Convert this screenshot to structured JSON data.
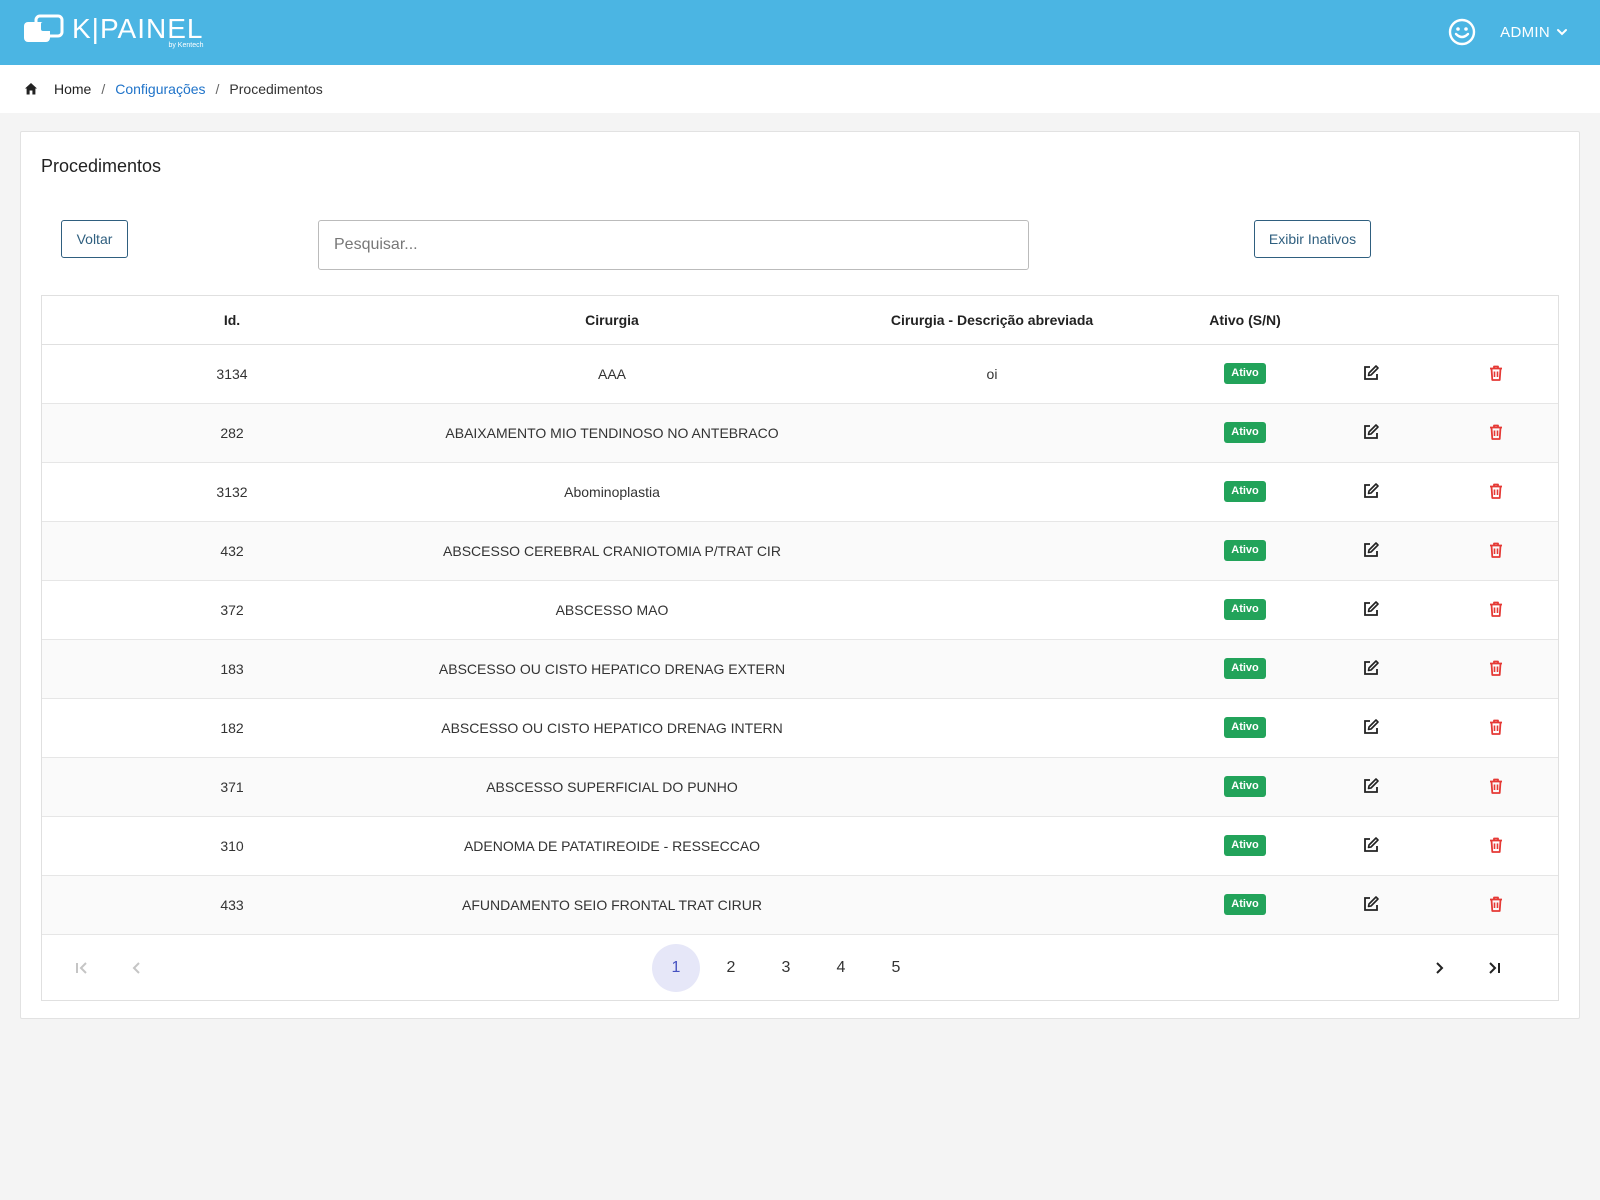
{
  "header": {
    "logo_text": "K|PAINEL",
    "logo_sub": "by Kentech",
    "user_label": "ADMIN"
  },
  "breadcrumb": {
    "home": "Home",
    "config": "Configurações",
    "current": "Procedimentos",
    "separator": "/"
  },
  "page": {
    "title": "Procedimentos",
    "back_label": "Voltar",
    "show_inactive_label": "Exibir Inativos",
    "search_placeholder": "Pesquisar..."
  },
  "table": {
    "columns": [
      "Id.",
      "Cirurgia",
      "Cirurgia - Descrição abreviada",
      "Ativo (S/N)",
      "",
      ""
    ],
    "rows": [
      {
        "id": "3134",
        "cirurgia": "AAA",
        "descricao": "oi",
        "status": "Ativo"
      },
      {
        "id": "282",
        "cirurgia": "ABAIXAMENTO MIO TENDINOSO NO ANTEBRACO",
        "descricao": "",
        "status": "Ativo"
      },
      {
        "id": "3132",
        "cirurgia": "Abominoplastia",
        "descricao": "",
        "status": "Ativo"
      },
      {
        "id": "432",
        "cirurgia": "ABSCESSO CEREBRAL CRANIOTOMIA P/TRAT CIR",
        "descricao": "",
        "status": "Ativo"
      },
      {
        "id": "372",
        "cirurgia": "ABSCESSO MAO",
        "descricao": "",
        "status": "Ativo"
      },
      {
        "id": "183",
        "cirurgia": "ABSCESSO OU CISTO HEPATICO DRENAG EXTERN",
        "descricao": "",
        "status": "Ativo"
      },
      {
        "id": "182",
        "cirurgia": "ABSCESSO OU CISTO HEPATICO DRENAG INTERN",
        "descricao": "",
        "status": "Ativo"
      },
      {
        "id": "371",
        "cirurgia": "ABSCESSO SUPERFICIAL DO PUNHO",
        "descricao": "",
        "status": "Ativo"
      },
      {
        "id": "310",
        "cirurgia": "ADENOMA DE PATATIREOIDE - RESSECCAO",
        "descricao": "",
        "status": "Ativo"
      },
      {
        "id": "433",
        "cirurgia": "AFUNDAMENTO SEIO FRONTAL TRAT CIRUR",
        "descricao": "",
        "status": "Ativo"
      }
    ]
  },
  "pagination": {
    "pages": [
      "1",
      "2",
      "3",
      "4",
      "5"
    ],
    "current": "1"
  },
  "colors": {
    "topbar": "#4bb5e3",
    "badge_active": "#22a35a",
    "delete_icon": "#e53935",
    "link": "#1f73c9",
    "page_active_bg": "#e6e7f8"
  }
}
